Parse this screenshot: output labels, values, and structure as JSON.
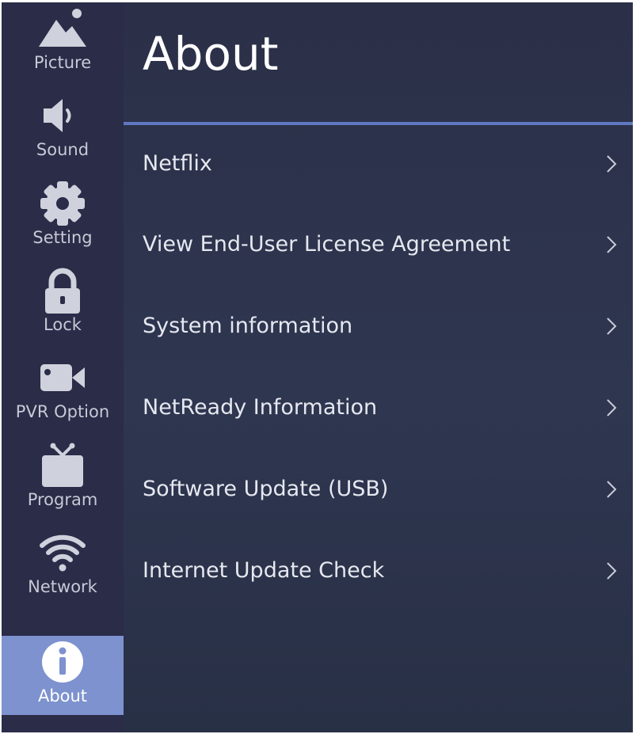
{
  "sidebar": {
    "items": [
      {
        "label": "Picture",
        "icon": "picture-icon"
      },
      {
        "label": "Sound",
        "icon": "speaker-icon"
      },
      {
        "label": "Setting",
        "icon": "gear-icon"
      },
      {
        "label": "Lock",
        "icon": "lock-icon"
      },
      {
        "label": "PVR Option",
        "icon": "video-camera-icon"
      },
      {
        "label": "Program",
        "icon": "tv-icon"
      },
      {
        "label": "Network",
        "icon": "wifi-icon"
      },
      {
        "label": "About",
        "icon": "info-icon",
        "selected": true
      }
    ]
  },
  "main": {
    "title": "About",
    "items": [
      {
        "label": "Netflix"
      },
      {
        "label": "View End-User License Agreement"
      },
      {
        "label": "System information"
      },
      {
        "label": "NetReady Information"
      },
      {
        "label": "Software Update (USB)"
      },
      {
        "label": "Internet Update Check"
      }
    ],
    "chevron_icon": "chevron-right-icon"
  },
  "colors": {
    "sidebar_bg": "#2a2c48",
    "main_bg": "#2c3047",
    "selected_bg": "#7d92cf",
    "divider": "#5f78bf",
    "text": "#e6e8f0"
  }
}
